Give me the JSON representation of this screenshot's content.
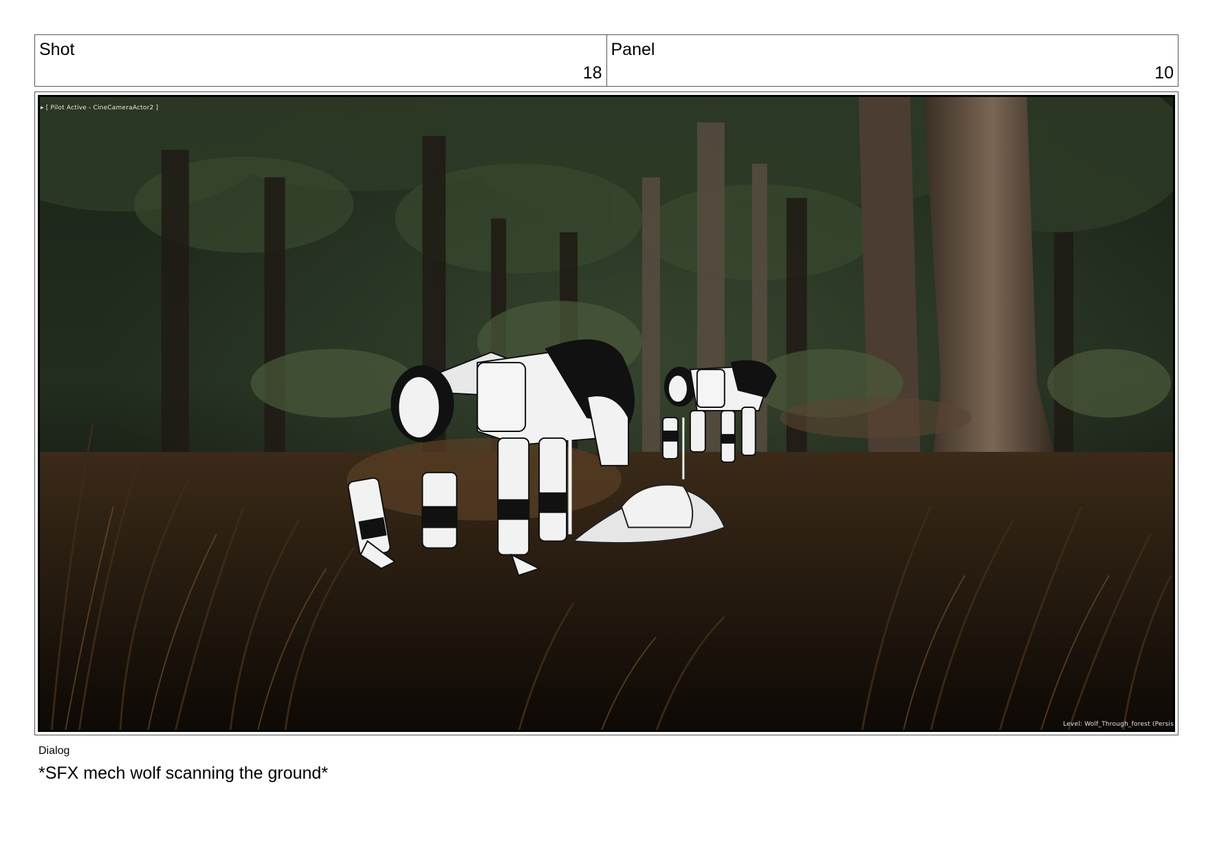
{
  "header": {
    "shot_label": "Shot",
    "shot_number": "18",
    "panel_label": "Panel",
    "panel_number": "10"
  },
  "frame": {
    "overlay_top_left": "▸ [ Pilot Active - CineCameraActor2 ]",
    "overlay_bottom_right": "Level:  Wolf_Through_forest (Persis"
  },
  "dialog": {
    "label": "Dialog",
    "text": "*SFX mech wolf scanning the ground*"
  }
}
